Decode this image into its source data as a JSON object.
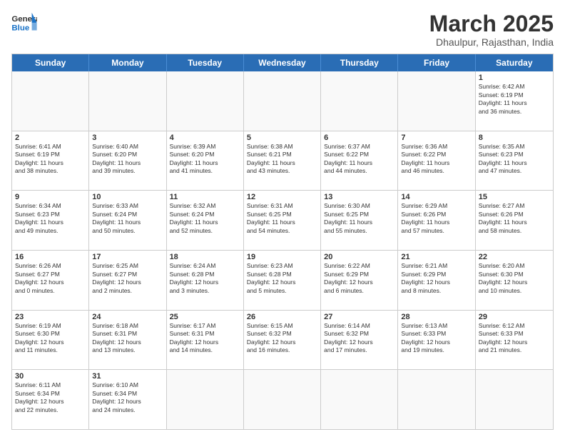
{
  "header": {
    "logo_general": "General",
    "logo_blue": "Blue",
    "month_title": "March 2025",
    "subtitle": "Dhaulpur, Rajasthan, India"
  },
  "weekdays": [
    "Sunday",
    "Monday",
    "Tuesday",
    "Wednesday",
    "Thursday",
    "Friday",
    "Saturday"
  ],
  "rows": [
    [
      {
        "day": "",
        "info": ""
      },
      {
        "day": "",
        "info": ""
      },
      {
        "day": "",
        "info": ""
      },
      {
        "day": "",
        "info": ""
      },
      {
        "day": "",
        "info": ""
      },
      {
        "day": "",
        "info": ""
      },
      {
        "day": "1",
        "info": "Sunrise: 6:42 AM\nSunset: 6:19 PM\nDaylight: 11 hours\nand 36 minutes."
      }
    ],
    [
      {
        "day": "2",
        "info": "Sunrise: 6:41 AM\nSunset: 6:19 PM\nDaylight: 11 hours\nand 38 minutes."
      },
      {
        "day": "3",
        "info": "Sunrise: 6:40 AM\nSunset: 6:20 PM\nDaylight: 11 hours\nand 39 minutes."
      },
      {
        "day": "4",
        "info": "Sunrise: 6:39 AM\nSunset: 6:20 PM\nDaylight: 11 hours\nand 41 minutes."
      },
      {
        "day": "5",
        "info": "Sunrise: 6:38 AM\nSunset: 6:21 PM\nDaylight: 11 hours\nand 43 minutes."
      },
      {
        "day": "6",
        "info": "Sunrise: 6:37 AM\nSunset: 6:22 PM\nDaylight: 11 hours\nand 44 minutes."
      },
      {
        "day": "7",
        "info": "Sunrise: 6:36 AM\nSunset: 6:22 PM\nDaylight: 11 hours\nand 46 minutes."
      },
      {
        "day": "8",
        "info": "Sunrise: 6:35 AM\nSunset: 6:23 PM\nDaylight: 11 hours\nand 47 minutes."
      }
    ],
    [
      {
        "day": "9",
        "info": "Sunrise: 6:34 AM\nSunset: 6:23 PM\nDaylight: 11 hours\nand 49 minutes."
      },
      {
        "day": "10",
        "info": "Sunrise: 6:33 AM\nSunset: 6:24 PM\nDaylight: 11 hours\nand 50 minutes."
      },
      {
        "day": "11",
        "info": "Sunrise: 6:32 AM\nSunset: 6:24 PM\nDaylight: 11 hours\nand 52 minutes."
      },
      {
        "day": "12",
        "info": "Sunrise: 6:31 AM\nSunset: 6:25 PM\nDaylight: 11 hours\nand 54 minutes."
      },
      {
        "day": "13",
        "info": "Sunrise: 6:30 AM\nSunset: 6:25 PM\nDaylight: 11 hours\nand 55 minutes."
      },
      {
        "day": "14",
        "info": "Sunrise: 6:29 AM\nSunset: 6:26 PM\nDaylight: 11 hours\nand 57 minutes."
      },
      {
        "day": "15",
        "info": "Sunrise: 6:27 AM\nSunset: 6:26 PM\nDaylight: 11 hours\nand 58 minutes."
      }
    ],
    [
      {
        "day": "16",
        "info": "Sunrise: 6:26 AM\nSunset: 6:27 PM\nDaylight: 12 hours\nand 0 minutes."
      },
      {
        "day": "17",
        "info": "Sunrise: 6:25 AM\nSunset: 6:27 PM\nDaylight: 12 hours\nand 2 minutes."
      },
      {
        "day": "18",
        "info": "Sunrise: 6:24 AM\nSunset: 6:28 PM\nDaylight: 12 hours\nand 3 minutes."
      },
      {
        "day": "19",
        "info": "Sunrise: 6:23 AM\nSunset: 6:28 PM\nDaylight: 12 hours\nand 5 minutes."
      },
      {
        "day": "20",
        "info": "Sunrise: 6:22 AM\nSunset: 6:29 PM\nDaylight: 12 hours\nand 6 minutes."
      },
      {
        "day": "21",
        "info": "Sunrise: 6:21 AM\nSunset: 6:29 PM\nDaylight: 12 hours\nand 8 minutes."
      },
      {
        "day": "22",
        "info": "Sunrise: 6:20 AM\nSunset: 6:30 PM\nDaylight: 12 hours\nand 10 minutes."
      }
    ],
    [
      {
        "day": "23",
        "info": "Sunrise: 6:19 AM\nSunset: 6:30 PM\nDaylight: 12 hours\nand 11 minutes."
      },
      {
        "day": "24",
        "info": "Sunrise: 6:18 AM\nSunset: 6:31 PM\nDaylight: 12 hours\nand 13 minutes."
      },
      {
        "day": "25",
        "info": "Sunrise: 6:17 AM\nSunset: 6:31 PM\nDaylight: 12 hours\nand 14 minutes."
      },
      {
        "day": "26",
        "info": "Sunrise: 6:15 AM\nSunset: 6:32 PM\nDaylight: 12 hours\nand 16 minutes."
      },
      {
        "day": "27",
        "info": "Sunrise: 6:14 AM\nSunset: 6:32 PM\nDaylight: 12 hours\nand 17 minutes."
      },
      {
        "day": "28",
        "info": "Sunrise: 6:13 AM\nSunset: 6:33 PM\nDaylight: 12 hours\nand 19 minutes."
      },
      {
        "day": "29",
        "info": "Sunrise: 6:12 AM\nSunset: 6:33 PM\nDaylight: 12 hours\nand 21 minutes."
      }
    ],
    [
      {
        "day": "30",
        "info": "Sunrise: 6:11 AM\nSunset: 6:34 PM\nDaylight: 12 hours\nand 22 minutes."
      },
      {
        "day": "31",
        "info": "Sunrise: 6:10 AM\nSunset: 6:34 PM\nDaylight: 12 hours\nand 24 minutes."
      },
      {
        "day": "",
        "info": ""
      },
      {
        "day": "",
        "info": ""
      },
      {
        "day": "",
        "info": ""
      },
      {
        "day": "",
        "info": ""
      },
      {
        "day": "",
        "info": ""
      }
    ]
  ]
}
